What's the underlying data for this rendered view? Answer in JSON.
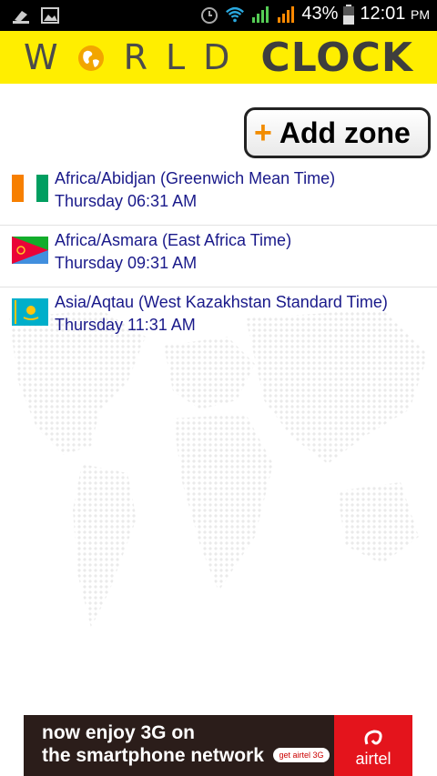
{
  "status_bar": {
    "battery": "43%",
    "time": "12:01",
    "ampm": "PM"
  },
  "header": {
    "world_text": "WORLD",
    "clock_text": "CLOCK"
  },
  "add_zone": {
    "plus": "+",
    "label": "Add zone"
  },
  "zones": [
    {
      "name": "Africa/Abidjan (Greenwich Mean Time)",
      "time": "Thursday 06:31 AM",
      "flag": "ivory-coast-flag"
    },
    {
      "name": "Africa/Asmara (East Africa Time)",
      "time": "Thursday 09:31 AM",
      "flag": "eritrea-flag"
    },
    {
      "name": "Asia/Aqtau (West Kazakhstan Standard Time)",
      "time": "Thursday 11:31 AM",
      "flag": "kazakhstan-flag"
    }
  ],
  "ad": {
    "line1": "now enjoy 3G on",
    "line2": "the smartphone network",
    "pill": "get airtel 3G",
    "brand": "airtel"
  },
  "colors": {
    "header_bg": "#ffee00",
    "link": "#19198a",
    "plus": "#f28c00"
  }
}
